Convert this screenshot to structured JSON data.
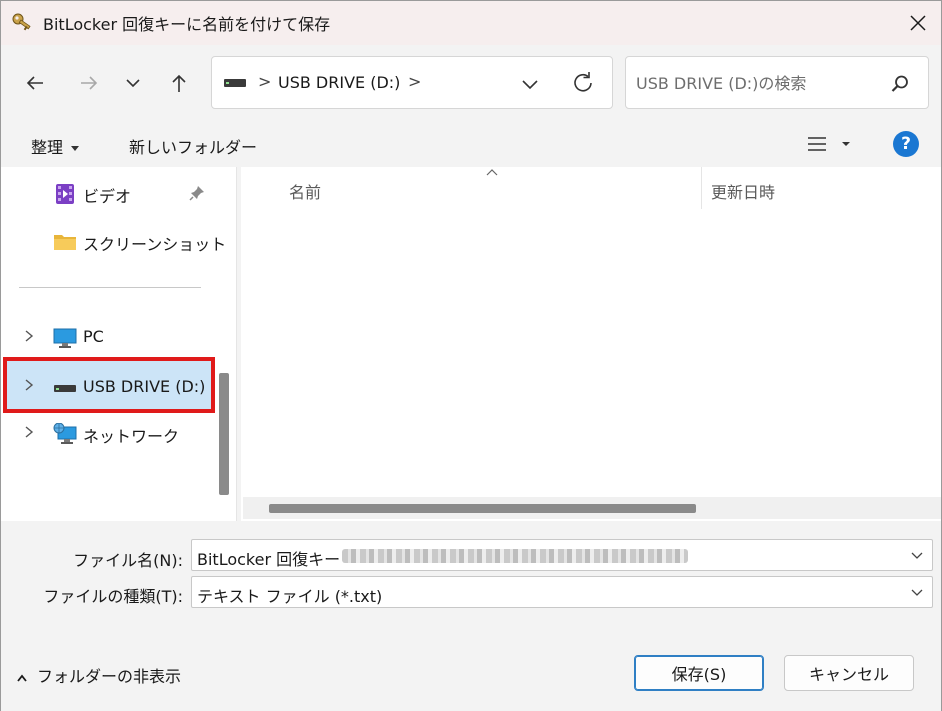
{
  "window": {
    "title": "BitLocker 回復キーに名前を付けて保存"
  },
  "address_bar": {
    "path": "USB DRIVE (D:)",
    "separator": ">"
  },
  "search": {
    "placeholder": "USB DRIVE (D:)の検索"
  },
  "toolbar": {
    "organize_label": "整理",
    "new_folder_label": "新しいフォルダー"
  },
  "nav_pane": {
    "items": [
      {
        "label": "ビデオ",
        "icon": "video-folder-icon",
        "pinned": true
      },
      {
        "label": "スクリーンショット",
        "icon": "folder-icon"
      },
      {
        "label": "PC",
        "icon": "monitor-icon"
      },
      {
        "label": "USB DRIVE (D:)",
        "icon": "drive-icon",
        "selected": true
      },
      {
        "label": "ネットワーク",
        "icon": "network-icon"
      }
    ]
  },
  "content": {
    "columns": [
      "名前",
      "更新日時"
    ]
  },
  "form": {
    "filename_label": "ファイル名(N):",
    "filename_value": "BitLocker 回復キー",
    "filetype_label": "ファイルの種類(T):",
    "filetype_value": "テキスト ファイル (*.txt)"
  },
  "footer": {
    "hide_folders_label": "フォルダーの非表示",
    "save_label": "保存(S)",
    "cancel_label": "キャンセル"
  },
  "colors": {
    "selection_bg": "#cce4f7",
    "highlight_border": "#e01a1a",
    "accent": "#1a77d2"
  }
}
